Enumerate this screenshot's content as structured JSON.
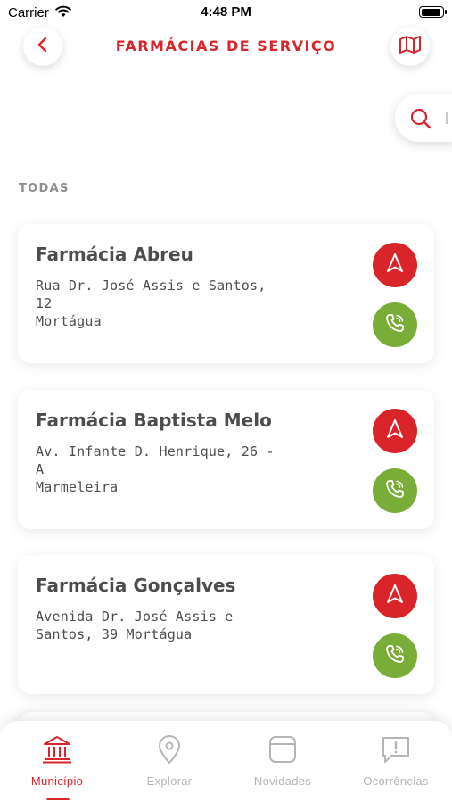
{
  "status_bar": {
    "carrier": "Carrier",
    "time": "4:48 PM"
  },
  "header": {
    "title": "FARMÁCIAS DE SERVIÇO"
  },
  "section": {
    "label": "TODAS"
  },
  "pharmacies": [
    {
      "name": "Farmácia Abreu",
      "address_line1": "Rua Dr. José Assis e Santos, 12",
      "address_line2": "Mortágua"
    },
    {
      "name": "Farmácia Baptista Melo",
      "address_line1": "Av. Infante D. Henrique, 26 - A",
      "address_line2": "Marmeleira"
    },
    {
      "name": "Farmácia Gonçalves",
      "address_line1": "Avenida Dr. José Assis e",
      "address_line2": "Santos, 39 Mortágua"
    }
  ],
  "tabs": [
    {
      "label": "Município",
      "icon": "municipality-icon",
      "active": true
    },
    {
      "label": "Explorar",
      "icon": "location-pin-icon",
      "active": false
    },
    {
      "label": "Novidades",
      "icon": "news-icon",
      "active": false
    },
    {
      "label": "Ocorrências",
      "icon": "alert-bubble-icon",
      "active": false
    }
  ],
  "colors": {
    "accent": "#d9252a",
    "call": "#7aac38",
    "inactive": "#b5b5b5"
  }
}
